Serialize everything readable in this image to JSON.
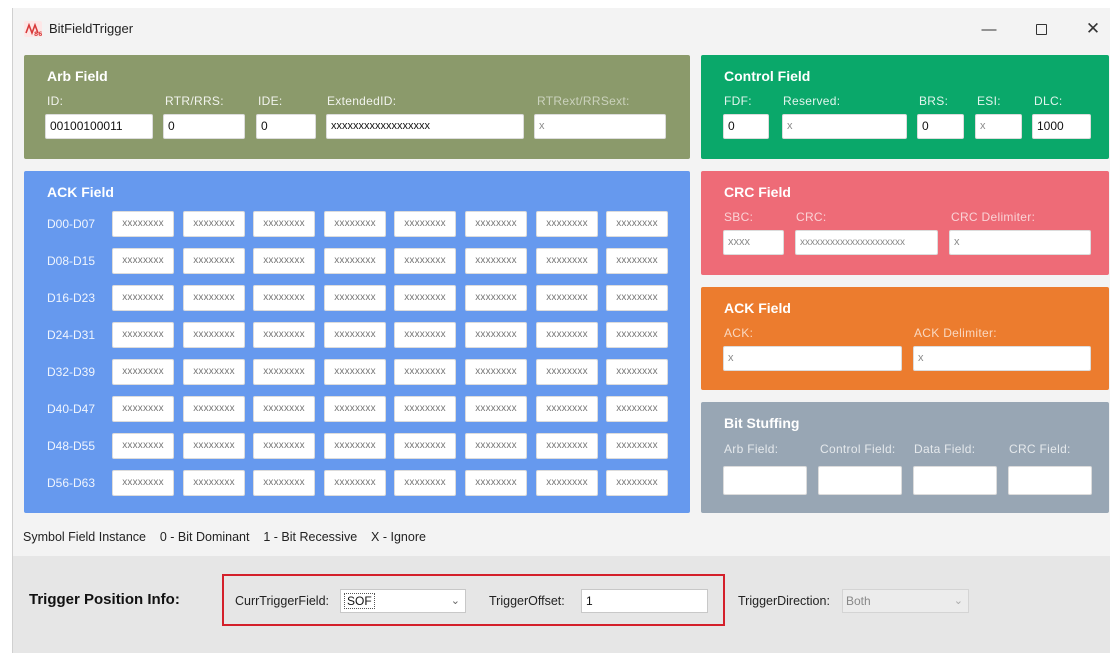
{
  "window": {
    "title": "BitFieldTrigger"
  },
  "arb": {
    "title": "Arb Field",
    "labels": {
      "id": "ID:",
      "rtr": "RTR/RRS:",
      "ide": "IDE:",
      "ext": "ExtendedID:",
      "rtrext": "RTRext/RRSext:"
    },
    "values": {
      "id": "00100100011",
      "rtr": "0",
      "ide": "0",
      "ext": "xxxxxxxxxxxxxxxxxx",
      "rtrext": "x"
    }
  },
  "control": {
    "title": "Control Field",
    "labels": {
      "fdf": "FDF:",
      "reserved": "Reserved:",
      "brs": "BRS:",
      "esi": "ESI:",
      "dlc": "DLC:"
    },
    "values": {
      "fdf": "0",
      "reserved": "x",
      "brs": "0",
      "esi": "x",
      "dlc": "1000"
    }
  },
  "data": {
    "title": "ACK Field",
    "rows": [
      {
        "label": "D00-D07",
        "cells": [
          "xxxxxxxx",
          "xxxxxxxx",
          "xxxxxxxx",
          "xxxxxxxx",
          "xxxxxxxx",
          "xxxxxxxx",
          "xxxxxxxx",
          "xxxxxxxx"
        ]
      },
      {
        "label": "D08-D15",
        "cells": [
          "xxxxxxxx",
          "xxxxxxxx",
          "xxxxxxxx",
          "xxxxxxxx",
          "xxxxxxxx",
          "xxxxxxxx",
          "xxxxxxxx",
          "xxxxxxxx"
        ]
      },
      {
        "label": "D16-D23",
        "cells": [
          "xxxxxxxx",
          "xxxxxxxx",
          "xxxxxxxx",
          "xxxxxxxx",
          "xxxxxxxx",
          "xxxxxxxx",
          "xxxxxxxx",
          "xxxxxxxx"
        ]
      },
      {
        "label": "D24-D31",
        "cells": [
          "xxxxxxxx",
          "xxxxxxxx",
          "xxxxxxxx",
          "xxxxxxxx",
          "xxxxxxxx",
          "xxxxxxxx",
          "xxxxxxxx",
          "xxxxxxxx"
        ]
      },
      {
        "label": "D32-D39",
        "cells": [
          "xxxxxxxx",
          "xxxxxxxx",
          "xxxxxxxx",
          "xxxxxxxx",
          "xxxxxxxx",
          "xxxxxxxx",
          "xxxxxxxx",
          "xxxxxxxx"
        ]
      },
      {
        "label": "D40-D47",
        "cells": [
          "xxxxxxxx",
          "xxxxxxxx",
          "xxxxxxxx",
          "xxxxxxxx",
          "xxxxxxxx",
          "xxxxxxxx",
          "xxxxxxxx",
          "xxxxxxxx"
        ]
      },
      {
        "label": "D48-D55",
        "cells": [
          "xxxxxxxx",
          "xxxxxxxx",
          "xxxxxxxx",
          "xxxxxxxx",
          "xxxxxxxx",
          "xxxxxxxx",
          "xxxxxxxx",
          "xxxxxxxx"
        ]
      },
      {
        "label": "D56-D63",
        "cells": [
          "xxxxxxxx",
          "xxxxxxxx",
          "xxxxxxxx",
          "xxxxxxxx",
          "xxxxxxxx",
          "xxxxxxxx",
          "xxxxxxxx",
          "xxxxxxxx"
        ]
      }
    ]
  },
  "crc": {
    "title": "CRC Field",
    "labels": {
      "sbc": "SBC:",
      "crc": "CRC:",
      "delim": "CRC Delimiter:"
    },
    "values": {
      "sbc": "xxxx",
      "crc": "xxxxxxxxxxxxxxxxxxxxx",
      "delim": "x"
    }
  },
  "ack": {
    "title": "ACK Field",
    "labels": {
      "ack": "ACK:",
      "delim": "ACK Delimiter:"
    },
    "values": {
      "ack": "x",
      "delim": "x"
    }
  },
  "stuffing": {
    "title": "Bit Stuffing",
    "labels": {
      "arb": "Arb Field:",
      "control": "Control Field:",
      "data": "Data Field:",
      "crc": "CRC Field:"
    },
    "values": {
      "arb": "",
      "control": "",
      "data": "",
      "crc": ""
    }
  },
  "legend": "Symbol Field Instance    0 - Bit Dominant    1 - Bit Recessive    X - Ignore",
  "trigger": {
    "title": "Trigger Position Info:",
    "field_label": "CurrTriggerField:",
    "field_value": "SOF",
    "offset_label": "TriggerOffset:",
    "offset_value": "1",
    "direction_label": "TriggerDirection:",
    "direction_value": "Both"
  },
  "colors": {
    "arb": "#8b9a6b",
    "control": "#0aa86a",
    "data": "#6699ee",
    "crc": "#ee6b77",
    "ack": "#ec7c2e",
    "stuffing": "#98a6b4",
    "highlight": "#d4202b"
  }
}
